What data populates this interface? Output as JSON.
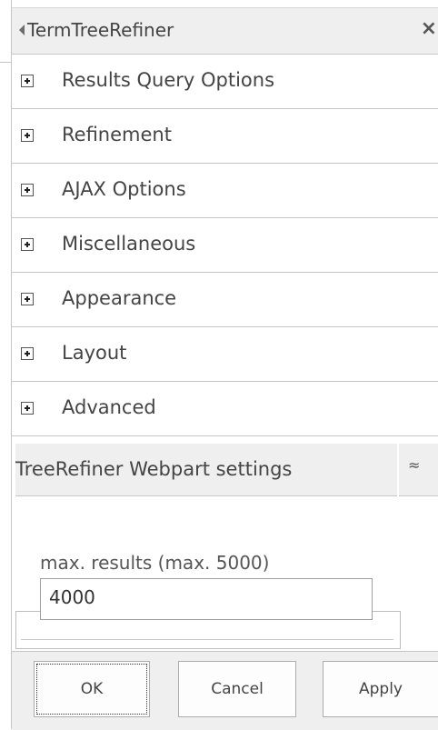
{
  "panel": {
    "title": "TermTreeRefiner",
    "close_symbol": "×"
  },
  "sections": [
    {
      "label": "Results Query Options"
    },
    {
      "label": "Refinement"
    },
    {
      "label": "AJAX Options"
    },
    {
      "label": "Miscellaneous"
    },
    {
      "label": "Appearance"
    },
    {
      "label": "Layout"
    },
    {
      "label": "Advanced"
    }
  ],
  "settings": {
    "header": "TreeRefiner Webpart settings",
    "collapse_symbol": "≈",
    "max_results_label": "max. results (max. 5000)",
    "max_results_value": "4000"
  },
  "footer": {
    "ok": "OK",
    "cancel": "Cancel",
    "apply": "Apply"
  }
}
